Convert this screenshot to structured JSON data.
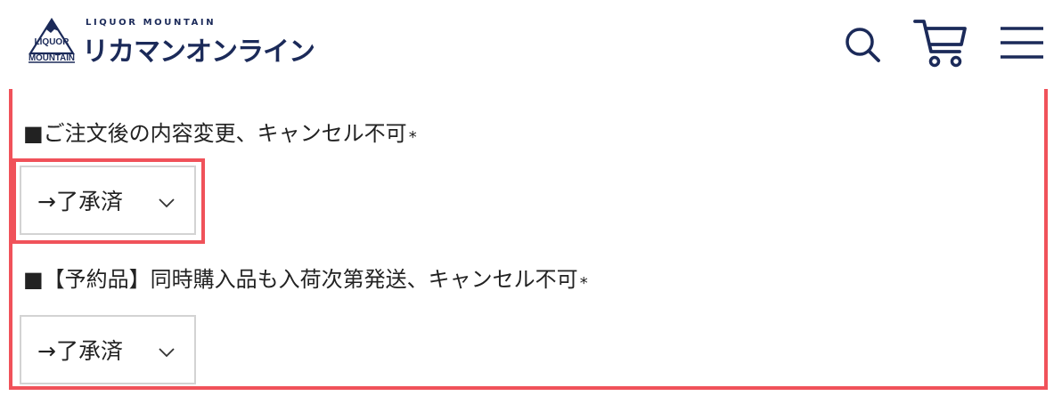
{
  "header": {
    "logo_subtitle": "LIQUOR MOUNTAIN",
    "logo_title": "リカマンオンライン",
    "logo_mark_text_top": "LIQUOR",
    "logo_mark_text_bottom": "MOUNTAIN",
    "icons": [
      "search-icon",
      "cart-icon",
      "hamburger-menu-icon"
    ],
    "brand_color": "#1b2a59"
  },
  "form": {
    "accent_color": "#f0525a",
    "fields": [
      {
        "label": "■ご注文後の内容変更、キャンセル不可",
        "required_mark": "*",
        "selected_value": "→了承済"
      },
      {
        "label": "■【予約品】同時購入品も入荷次第発送、キャンセル不可",
        "required_mark": "*",
        "selected_value": "→了承済"
      }
    ]
  }
}
